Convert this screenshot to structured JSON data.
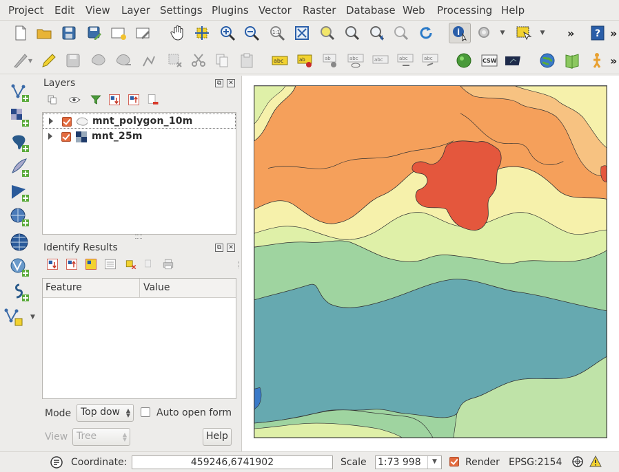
{
  "menubar": {
    "items": [
      "Project",
      "Edit",
      "View",
      "Layer",
      "Settings",
      "Plugins",
      "Vector",
      "Raster",
      "Database",
      "Web",
      "Processing",
      "Help"
    ]
  },
  "toolbar": {
    "overflow": "»"
  },
  "layers_panel": {
    "title": "Layers",
    "layers": [
      {
        "name": "mnt_polygon_10m",
        "type_icon": "polygon-layer-icon",
        "checked": true
      },
      {
        "name": "mnt_25m",
        "type_icon": "raster-layer-icon",
        "checked": true
      }
    ]
  },
  "identify_panel": {
    "title": "Identify Results",
    "columns": [
      "Feature",
      "Value"
    ],
    "mode_label": "Mode",
    "mode_value": "Top dow",
    "auto_open_label": "Auto open form",
    "view_label": "View",
    "view_value": "Tree",
    "help_button": "Help"
  },
  "statusbar": {
    "coordinate_label": "Coordinate:",
    "coordinate_value": "459246,6741902",
    "scale_label": "Scale",
    "scale_value": "1:73 998",
    "render_label": "Render",
    "crs": "EPSG:2154"
  },
  "colors": {
    "accent_checkbox": "#e36b3e",
    "map_water": "#66a9b0",
    "map_low": "#9fd4a0",
    "map_mid": "#f6f1ab",
    "map_high": "#f5a05b",
    "map_peak": "#e4573d"
  }
}
